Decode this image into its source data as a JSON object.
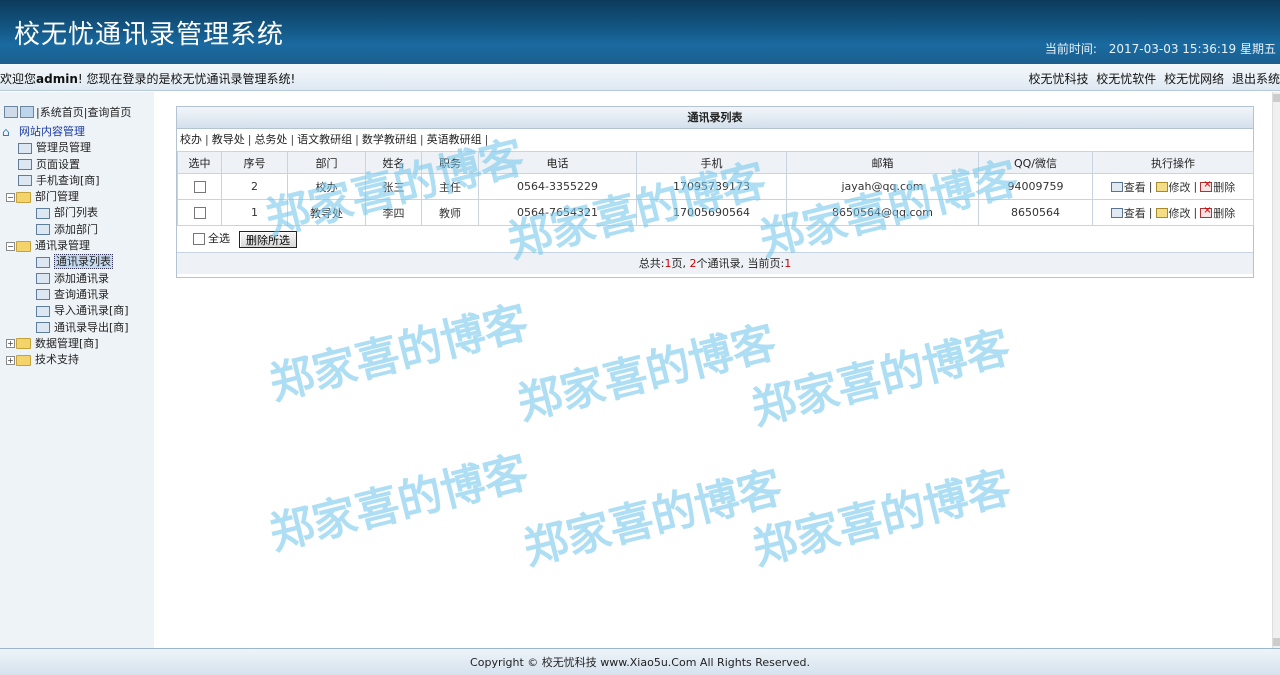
{
  "header": {
    "title": "校无忧通讯录管理系统",
    "time_label": "当前时间:",
    "time_value": "2017-03-03 15:36:19 星期五"
  },
  "welcome": {
    "prefix": "欢迎您",
    "username": "admin",
    "suffix": "! 您现在登录的是校无忧通讯录管理系统!",
    "links": [
      "校无忧科技",
      "校无忧软件",
      "校无忧网络",
      "退出系统"
    ]
  },
  "sidebar": {
    "top_links": [
      "系统首页",
      "查询首页"
    ],
    "root": "网站内容管理",
    "items": [
      {
        "label": "管理员管理"
      },
      {
        "label": "页面设置"
      },
      {
        "label": "手机查询[商]"
      },
      {
        "label": "部门管理"
      },
      {
        "label": "部门列表"
      },
      {
        "label": "添加部门"
      },
      {
        "label": "通讯录管理"
      },
      {
        "label": "通讯录列表"
      },
      {
        "label": "添加通讯录"
      },
      {
        "label": "查询通讯录"
      },
      {
        "label": "导入通讯录[商]"
      },
      {
        "label": "通讯录导出[商]"
      },
      {
        "label": "数据管理[商]"
      },
      {
        "label": "技术支持"
      }
    ]
  },
  "panel": {
    "title": "通讯录列表",
    "departments": [
      "校办",
      "教导处",
      "总务处",
      "语文教研组",
      "数学教研组",
      "英语教研组"
    ],
    "columns": [
      "选中",
      "序号",
      "部门",
      "姓名",
      "职务",
      "电话",
      "手机",
      "邮箱",
      "QQ/微信",
      "执行操作"
    ],
    "rows": [
      {
        "id": "2",
        "dept": "校办",
        "name": "张三",
        "title": "主任",
        "phone": "0564-3355229",
        "mobile": "17095739173",
        "email": "jayah@qq.com",
        "qq": "94009759"
      },
      {
        "id": "1",
        "dept": "教导处",
        "name": "李四",
        "title": "教师",
        "phone": "0564-7654321",
        "mobile": "17005690564",
        "email": "8650564@qq.com",
        "qq": "8650564"
      }
    ],
    "ops": {
      "view": "查看",
      "edit": "修改",
      "delete": "删除"
    },
    "select_all": "全选",
    "delete_selected": "删除所选",
    "pager": {
      "p1": "总共:",
      "total_pages": "1",
      "p2": "页, ",
      "total_records": "2",
      "p3": "个通讯录, 当前页:",
      "current": "1"
    }
  },
  "footer": {
    "copyright": "Copyright © 校无忧科技  www.Xiao5u.Com All Rights Reserved."
  },
  "watermark": "郑家喜的博客",
  "colors": {
    "header_bg": "#135785",
    "watermark": "#78c8eb",
    "pager_red": "#cc0000"
  }
}
